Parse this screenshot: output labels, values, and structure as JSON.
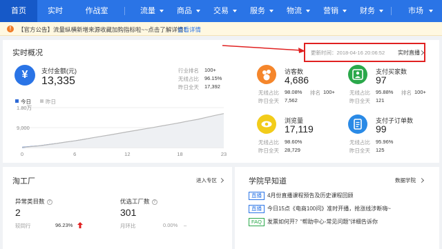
{
  "nav": {
    "items": [
      {
        "label": "首页",
        "active": true
      },
      {
        "label": "实时"
      },
      {
        "label": "作战室"
      },
      {
        "label": "流量"
      },
      {
        "label": "商品"
      },
      {
        "label": "交易"
      },
      {
        "label": "服务"
      },
      {
        "label": "物流"
      },
      {
        "label": "营销"
      },
      {
        "label": "财务"
      },
      {
        "label": "市场"
      }
    ]
  },
  "notice": {
    "text": "【官方公告】流量纵横新增来源收藏加购指标啦~~点击了解详情！",
    "link": "查看详情"
  },
  "realtime": {
    "title": "实时概况",
    "update_time": "更新时间：2018-04-16 20:06:52",
    "live_link": "实时直播",
    "payment": {
      "label": "支付金额(元)",
      "value": "13,335",
      "rank_label": "行业排名",
      "rank_value": "100+",
      "wireless_label": "无线占比",
      "wireless_value": "96.15%",
      "yesterday_label": "昨日全天",
      "yesterday_value": "17,392"
    },
    "legend": {
      "today": "今日",
      "yesterday": "昨日"
    },
    "metrics": [
      {
        "label": "访客数",
        "value": "4,686",
        "wireless_label": "无线占比",
        "wireless_value": "98.08%",
        "rank_label": "排名",
        "rank_value": "100+",
        "yesterday_label": "昨日全天",
        "yesterday_value": "7,562",
        "color": "#f5862b"
      },
      {
        "label": "支付买家数",
        "value": "97",
        "wireless_label": "无线占比",
        "wireless_value": "95.88%",
        "rank_label": "排名",
        "rank_value": "100+",
        "yesterday_label": "昨日全天",
        "yesterday_value": "121",
        "color": "#2aa84a"
      },
      {
        "label": "浏览量",
        "value": "17,119",
        "wireless_label": "无线占比",
        "wireless_value": "98.60%",
        "yesterday_label": "昨日全天",
        "yesterday_value": "28,729",
        "color": "#f2cc1a"
      },
      {
        "label": "支付子订单数",
        "value": "99",
        "wireless_label": "无线占比",
        "wireless_value": "95.96%",
        "yesterday_label": "昨日全天",
        "yesterday_value": "125",
        "color": "#2a8ae6"
      }
    ]
  },
  "factory": {
    "title": "淘工厂",
    "enter_link": "进入专区",
    "abnormal_label": "异常类目数",
    "abnormal_value": "2",
    "compare_label": "较同行",
    "compare_value": "96.23%",
    "preferred_label": "优选工厂数",
    "preferred_value": "301",
    "mom_label": "月环比",
    "mom_value": "0.00%",
    "dash": "–"
  },
  "academy": {
    "title": "学院早知道",
    "link": "数据学院",
    "items": [
      {
        "tag": "直播",
        "text": "4月份直播课程预告及历史课程回顾"
      },
      {
        "tag": "直播",
        "text": "今日15点《电商100问》准时开播，抢涨线涉断嗨~"
      },
      {
        "tag": "FAQ",
        "text": "发票如何开？“帮助中心-常见问题”详细告诉你"
      }
    ]
  },
  "chart_data": {
    "type": "area",
    "x": [
      0,
      1,
      2,
      3,
      4,
      5,
      6,
      7,
      8,
      9,
      10,
      11,
      12,
      13,
      14,
      15,
      16,
      17,
      18,
      19,
      20,
      21,
      22,
      23
    ],
    "xticks": [
      "0",
      "6",
      "12",
      "18",
      "23"
    ],
    "yticks": [
      "1.80万",
      "9,000"
    ],
    "ylim": [
      0,
      18000
    ],
    "series": [
      {
        "name": "今日",
        "color": "#2f6ad6",
        "values": [
          80,
          420,
          750,
          1300,
          1800,
          2400,
          2950,
          3600,
          4250,
          4900,
          5550,
          6200,
          6900,
          7550,
          8200,
          8800,
          9400,
          10000,
          10650,
          11300,
          11600
        ]
      },
      {
        "name": "昨日",
        "color": "#b8b8b8",
        "values": [
          100,
          450,
          800,
          1350,
          1900,
          2500,
          3050,
          3700,
          4400,
          5050,
          5700,
          6400,
          7100,
          7750,
          8450,
          9100,
          9800,
          10500,
          11200,
          12000,
          12700,
          13600,
          14500,
          15300
        ]
      }
    ]
  }
}
